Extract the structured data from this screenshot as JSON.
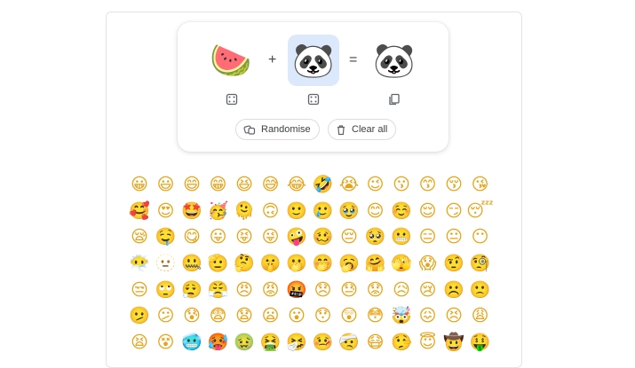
{
  "mixer": {
    "left_emoji": {
      "glyph": "🍉",
      "icon": "watermelon-icon"
    },
    "plus": "+",
    "right_emoji": {
      "glyph": "🐼",
      "icon": "panda-icon"
    },
    "equals": "=",
    "result_emoji": {
      "glyph": "🐼",
      "icon": "panda-watermelon-mashup-icon"
    },
    "left_action_icon": "dice-icon",
    "right_action_icon": "dice-icon",
    "result_action_icon": "copy-icon",
    "randomise_label": "Randomise",
    "clear_label": "Clear all"
  },
  "colors": {
    "accent_selected": "#dce8fb",
    "emoji_yellow": "#fbc21a"
  },
  "emoji_grid": [
    "😀",
    "😃",
    "😄",
    "😁",
    "😆",
    "😅",
    "😂",
    "🤣",
    "😭",
    "😉",
    "😗",
    "😙",
    "😚",
    "😘",
    "🥰",
    "😍",
    "🤩",
    "🥳",
    "🫠",
    "🙃",
    "🙂",
    "🥲",
    "🥹",
    "😊",
    "☺️",
    "😌",
    "😏",
    "😴",
    "😪",
    "🤤",
    "😋",
    "😛",
    "😝",
    "😜",
    "🤪",
    "🥴",
    "😔",
    "🥺",
    "😬",
    "😑",
    "😐",
    "😶",
    "😶‍🌫️",
    "🫥",
    "🤐",
    "🫡",
    "🤔",
    "🤫",
    "🫢",
    "🤭",
    "🥱",
    "🤗",
    "🫣",
    "😱",
    "🤨",
    "🧐",
    "😒",
    "🙄",
    "😮‍💨",
    "😤",
    "😠",
    "😡",
    "🤬",
    "😞",
    "😓",
    "😟",
    "😥",
    "😢",
    "☹️",
    "🙁",
    "🫤",
    "😕",
    "😰",
    "😨",
    "😧",
    "😦",
    "😮",
    "😯",
    "😲",
    "😳",
    "🤯",
    "😖",
    "😣",
    "😩",
    "😫",
    "😵",
    "🥶",
    "🥵",
    "🤢",
    "🤮",
    "🤧",
    "🤒",
    "🤕",
    "😷",
    "🤥",
    "😇",
    "🤠",
    "🤑"
  ]
}
